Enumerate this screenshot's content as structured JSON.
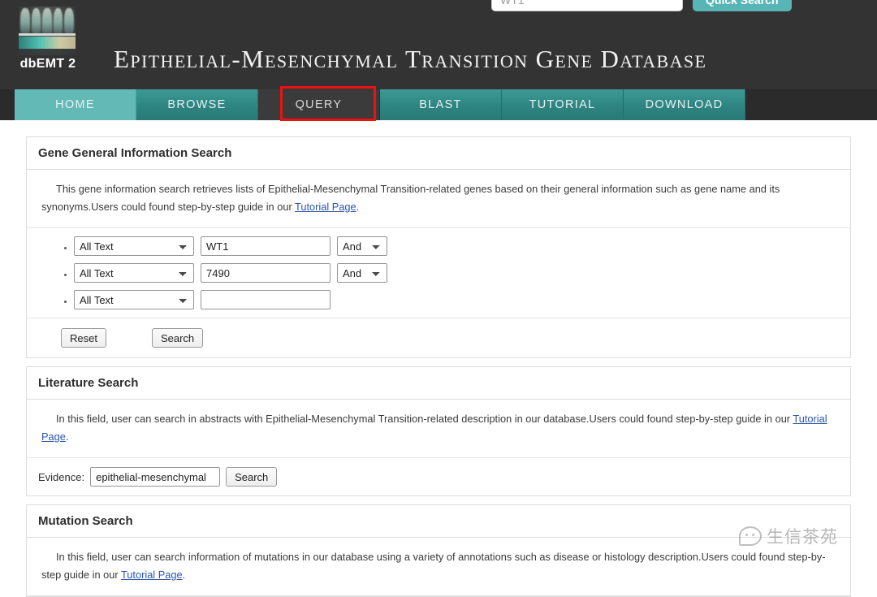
{
  "header": {
    "logo_text": "dbEMT 2",
    "site_title": "Epithelial-Mesenchymal Transition Gene Database",
    "quick_search": {
      "placeholder": "WT1",
      "value": "",
      "button_label": "Quick Search"
    }
  },
  "nav": {
    "tabs": [
      {
        "label": "HOME",
        "state": "home"
      },
      {
        "label": "BROWSE",
        "state": "normal"
      },
      {
        "label": "QUERY",
        "state": "active"
      },
      {
        "label": "BLAST",
        "state": "normal"
      },
      {
        "label": "TUTORIAL",
        "state": "normal"
      },
      {
        "label": "DOWNLOAD",
        "state": "normal"
      }
    ],
    "highlight_tab": "QUERY"
  },
  "gene_panel": {
    "title": "Gene General Information Search",
    "description_before_link": "This gene information search retrieves lists of Epithelial-Mesenchymal Transition-related genes based on their general information such as gene name and its synonyms.Users could found step-by-step guide in our ",
    "link_label": "Tutorial Page",
    "description_after_link": ".",
    "rows": [
      {
        "field_value": "All Text",
        "term_value": "WT1",
        "term_placeholder": "",
        "operator_value": "And",
        "has_operator": true
      },
      {
        "field_value": "All Text",
        "term_value": "7490",
        "term_placeholder": "",
        "operator_value": "And",
        "has_operator": true
      },
      {
        "field_value": "All Text",
        "term_value": "",
        "term_placeholder": "",
        "operator_value": "",
        "has_operator": false
      }
    ],
    "field_options": [
      "All Text"
    ],
    "operator_options": [
      "And"
    ],
    "reset_label": "Reset",
    "search_label": "Search"
  },
  "literature_panel": {
    "title": "Literature Search",
    "description_before_link": "In this field, user can search in abstracts with Epithelial-Mesenchymal Transition-related description in our database.Users could found step-by-step guide in our ",
    "link_label": "Tutorial Page",
    "description_after_link": ".",
    "evidence_label": "Evidence:",
    "evidence_value": "epithelial-mesenchymal",
    "evidence_placeholder": "",
    "search_label": "Search"
  },
  "mutation_panel": {
    "title": "Mutation Search",
    "description_before_link": "In this field, user can search information of mutations in our database using a variety of annotations such as disease or histology description.Users could found step-by-step guide in our ",
    "link_label": "Tutorial Page",
    "description_after_link": "."
  },
  "watermark": {
    "text": "生信茶苑"
  },
  "colors": {
    "header_bg": "#333333",
    "nav_teal": "#2e8481",
    "nav_home_teal": "#63b9b6",
    "nav_active_dark": "#3b3b3b",
    "highlight_red": "#ee1111",
    "accent_button": "#57b5b5",
    "link_blue": "#2a56a8"
  }
}
